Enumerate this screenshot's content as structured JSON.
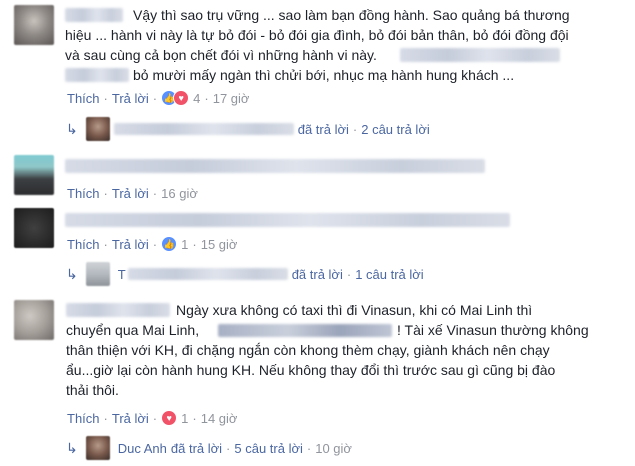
{
  "actions": {
    "like": "Thích",
    "reply": "Trả lời",
    "sep": "·"
  },
  "comments": [
    {
      "text_line1_tail": "Vậy thì sao trụ vững ... sao làm bạn đồng hành. Sao quảng bá thương",
      "text_line2": "hiệu ... hành vi này là tự bỏ đói - bỏ đói gia đình, bỏ đói bản thân, bỏ đói đồng đội",
      "text_line3": "và sau cùng cả bọn chết đói vì những hành vi này.",
      "text_line4_tail": "bỏ mười mấy ngàn thì chửi bới, nhục mạ hành hung khách ...",
      "reaction_count": "4",
      "time": "17 giờ",
      "reply_summary": {
        "replied": "đã trả lời",
        "count": "2 câu trả lời"
      }
    },
    {
      "time": "16 giờ"
    },
    {
      "reaction_count": "1",
      "time": "15 giờ",
      "reply_summary": {
        "prefix": "T",
        "replied": "đã trả lời",
        "count": "1 câu trả lời"
      }
    },
    {
      "text_line1_tail": "Ngày xưa không có taxi thì đi Vinasun, khi có Mai Linh thì",
      "text_line2_head": "chuyển qua Mai Linh,",
      "text_line2_tail": "! Tài xế Vinasun thường không",
      "text_line3": "thân thiện với KH, đi chặng ngắn còn khong thèm chạy, giành khách nên chạy",
      "text_line4": "ẩu...giờ lại còn hành hung KH. Nếu không thay đổi thì trước sau gì cũng bị đào",
      "text_line5": "thải thôi.",
      "reaction_count": "1",
      "time": "14 giờ",
      "reply_summary": {
        "name": "Duc Anh",
        "replied": "đã trả lời",
        "count": "5 câu trả lời",
        "time": "10 giờ"
      }
    }
  ],
  "icons": {
    "like": "like-reaction-icon",
    "love": "love-reaction-icon",
    "reply": "reply-arrow-icon"
  },
  "colors": {
    "link": "#4b67a1",
    "meta": "#90949c",
    "like": "#5890ff",
    "love": "#f25268"
  }
}
